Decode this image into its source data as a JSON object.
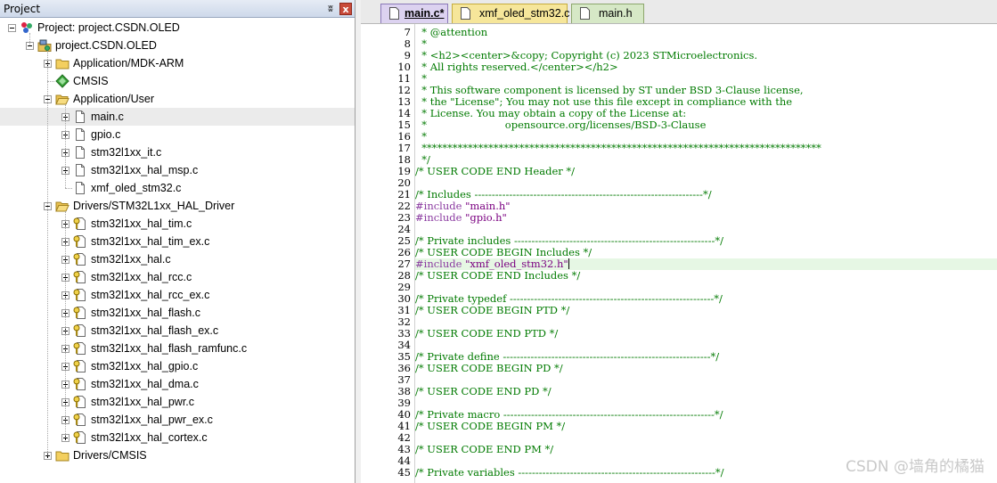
{
  "project_panel": {
    "title": "Project",
    "pin_glyph": "ʬ",
    "close_glyph": "x",
    "tree": [
      {
        "label": "Project: project.CSDN.OLED",
        "level": 0,
        "expander": "minus",
        "icon": "project-icon"
      },
      {
        "label": "project.CSDN.OLED",
        "level": 1,
        "expander": "minus",
        "icon": "target-icon"
      },
      {
        "label": "Application/MDK-ARM",
        "level": 2,
        "expander": "plus",
        "icon": "folder-icon"
      },
      {
        "label": "CMSIS",
        "level": 2,
        "expander": "none",
        "icon": "cmsis-icon"
      },
      {
        "label": "Application/User",
        "level": 2,
        "expander": "minus",
        "icon": "folder-open-icon"
      },
      {
        "label": "main.c",
        "level": 3,
        "expander": "plus",
        "icon": "file-icon",
        "selected": true
      },
      {
        "label": "gpio.c",
        "level": 3,
        "expander": "plus",
        "icon": "file-icon"
      },
      {
        "label": "stm32l1xx_it.c",
        "level": 3,
        "expander": "plus",
        "icon": "file-icon"
      },
      {
        "label": "stm32l1xx_hal_msp.c",
        "level": 3,
        "expander": "plus",
        "icon": "file-icon"
      },
      {
        "label": "xmf_oled_stm32.c",
        "level": 3,
        "expander": "none",
        "icon": "file-icon"
      },
      {
        "label": "Drivers/STM32L1xx_HAL_Driver",
        "level": 2,
        "expander": "minus",
        "icon": "folder-open-icon"
      },
      {
        "label": "stm32l1xx_hal_tim.c",
        "level": 3,
        "expander": "plus",
        "icon": "locked-file-icon"
      },
      {
        "label": "stm32l1xx_hal_tim_ex.c",
        "level": 3,
        "expander": "plus",
        "icon": "locked-file-icon"
      },
      {
        "label": "stm32l1xx_hal.c",
        "level": 3,
        "expander": "plus",
        "icon": "locked-file-icon"
      },
      {
        "label": "stm32l1xx_hal_rcc.c",
        "level": 3,
        "expander": "plus",
        "icon": "locked-file-icon"
      },
      {
        "label": "stm32l1xx_hal_rcc_ex.c",
        "level": 3,
        "expander": "plus",
        "icon": "locked-file-icon"
      },
      {
        "label": "stm32l1xx_hal_flash.c",
        "level": 3,
        "expander": "plus",
        "icon": "locked-file-icon"
      },
      {
        "label": "stm32l1xx_hal_flash_ex.c",
        "level": 3,
        "expander": "plus",
        "icon": "locked-file-icon"
      },
      {
        "label": "stm32l1xx_hal_flash_ramfunc.c",
        "level": 3,
        "expander": "plus",
        "icon": "locked-file-icon"
      },
      {
        "label": "stm32l1xx_hal_gpio.c",
        "level": 3,
        "expander": "plus",
        "icon": "locked-file-icon"
      },
      {
        "label": "stm32l1xx_hal_dma.c",
        "level": 3,
        "expander": "plus",
        "icon": "locked-file-icon"
      },
      {
        "label": "stm32l1xx_hal_pwr.c",
        "level": 3,
        "expander": "plus",
        "icon": "locked-file-icon"
      },
      {
        "label": "stm32l1xx_hal_pwr_ex.c",
        "level": 3,
        "expander": "plus",
        "icon": "locked-file-icon"
      },
      {
        "label": "stm32l1xx_hal_cortex.c",
        "level": 3,
        "expander": "plus",
        "icon": "locked-file-icon"
      },
      {
        "label": "Drivers/CMSIS",
        "level": 2,
        "expander": "plus",
        "icon": "folder-icon"
      }
    ]
  },
  "editor": {
    "tabs": [
      {
        "label": "main.c*",
        "active": true
      },
      {
        "label": "xmf_oled_stm32.c",
        "active": false
      },
      {
        "label": "main.h",
        "active": false
      }
    ],
    "current_line": 27,
    "lines": [
      {
        "n": "7",
        "parts": [
          {
            "t": "  * @attention",
            "k": "cm"
          }
        ]
      },
      {
        "n": "8",
        "parts": [
          {
            "t": "  *",
            "k": "cm"
          }
        ]
      },
      {
        "n": "9",
        "parts": [
          {
            "t": "  * <h2><center>&copy; Copyright (c) 2023 STMicroelectronics.",
            "k": "cm"
          }
        ]
      },
      {
        "n": "10",
        "parts": [
          {
            "t": "  * All rights reserved.</center></h2>",
            "k": "cm"
          }
        ]
      },
      {
        "n": "11",
        "parts": [
          {
            "t": "  *",
            "k": "cm"
          }
        ]
      },
      {
        "n": "12",
        "parts": [
          {
            "t": "  * This software component is licensed by ST under BSD 3-Clause license,",
            "k": "cm"
          }
        ]
      },
      {
        "n": "13",
        "parts": [
          {
            "t": "  * the \"License\"; You may not use this file except in compliance with the",
            "k": "cm"
          }
        ]
      },
      {
        "n": "14",
        "parts": [
          {
            "t": "  * License. You may obtain a copy of the License at:",
            "k": "cm"
          }
        ]
      },
      {
        "n": "15",
        "parts": [
          {
            "t": "  *                        opensource.org/licenses/BSD-3-Clause",
            "k": "cm"
          }
        ]
      },
      {
        "n": "16",
        "parts": [
          {
            "t": "  *",
            "k": "cm"
          }
        ]
      },
      {
        "n": "17",
        "parts": [
          {
            "t": "  ******************************************************************************",
            "k": "cm"
          }
        ]
      },
      {
        "n": "18",
        "parts": [
          {
            "t": "  */",
            "k": "cm"
          }
        ]
      },
      {
        "n": "19",
        "parts": [
          {
            "t": "/* USER CODE END Header */",
            "k": "cm"
          }
        ]
      },
      {
        "n": "20",
        "parts": []
      },
      {
        "n": "21",
        "parts": [
          {
            "t": "/* Includes ------------------------------------------------------------------*/",
            "k": "cm"
          }
        ]
      },
      {
        "n": "22",
        "parts": [
          {
            "t": "#include ",
            "k": "pp"
          },
          {
            "t": "\"main.h\"",
            "k": "str"
          }
        ]
      },
      {
        "n": "23",
        "parts": [
          {
            "t": "#include ",
            "k": "pp"
          },
          {
            "t": "\"gpio.h\"",
            "k": "str"
          }
        ]
      },
      {
        "n": "24",
        "parts": []
      },
      {
        "n": "25",
        "parts": [
          {
            "t": "/* Private includes ----------------------------------------------------------*/",
            "k": "cm"
          }
        ]
      },
      {
        "n": "26",
        "parts": [
          {
            "t": "/* USER CODE BEGIN Includes */",
            "k": "cm"
          }
        ]
      },
      {
        "n": "27",
        "parts": [
          {
            "t": "#include ",
            "k": "pp"
          },
          {
            "t": "\"xmf_oled_stm32.h\"",
            "k": "str"
          }
        ]
      },
      {
        "n": "28",
        "parts": [
          {
            "t": "/* USER CODE END Includes */",
            "k": "cm"
          }
        ]
      },
      {
        "n": "29",
        "parts": []
      },
      {
        "n": "30",
        "parts": [
          {
            "t": "/* Private typedef -----------------------------------------------------------*/",
            "k": "cm"
          }
        ]
      },
      {
        "n": "31",
        "parts": [
          {
            "t": "/* USER CODE BEGIN PTD */",
            "k": "cm"
          }
        ]
      },
      {
        "n": "32",
        "parts": []
      },
      {
        "n": "33",
        "parts": [
          {
            "t": "/* USER CODE END PTD */",
            "k": "cm"
          }
        ]
      },
      {
        "n": "34",
        "parts": []
      },
      {
        "n": "35",
        "parts": [
          {
            "t": "/* Private define ------------------------------------------------------------*/",
            "k": "cm"
          }
        ]
      },
      {
        "n": "36",
        "parts": [
          {
            "t": "/* USER CODE BEGIN PD */",
            "k": "cm"
          }
        ]
      },
      {
        "n": "37",
        "parts": []
      },
      {
        "n": "38",
        "parts": [
          {
            "t": "/* USER CODE END PD */",
            "k": "cm"
          }
        ]
      },
      {
        "n": "39",
        "parts": []
      },
      {
        "n": "40",
        "parts": [
          {
            "t": "/* Private macro -------------------------------------------------------------*/",
            "k": "cm"
          }
        ]
      },
      {
        "n": "41",
        "parts": [
          {
            "t": "/* USER CODE BEGIN PM */",
            "k": "cm"
          }
        ]
      },
      {
        "n": "42",
        "parts": []
      },
      {
        "n": "43",
        "parts": [
          {
            "t": "/* USER CODE END PM */",
            "k": "cm"
          }
        ]
      },
      {
        "n": "44",
        "parts": []
      },
      {
        "n": "45",
        "parts": [
          {
            "t": "/* Private variables ---------------------------------------------------------*/",
            "k": "cm"
          }
        ]
      }
    ]
  },
  "watermark": "CSDN @墙角的橘猫",
  "colors": {
    "comment": "#007a00",
    "preprocessor": "#8a3aa0",
    "string": "#7a0080",
    "current_line_bg": "#e6f7e4",
    "active_tab_bg": "#dcd2f0",
    "c_file_tab_bg": "#f6e69a",
    "h_file_tab_bg": "#d6e8c6"
  }
}
